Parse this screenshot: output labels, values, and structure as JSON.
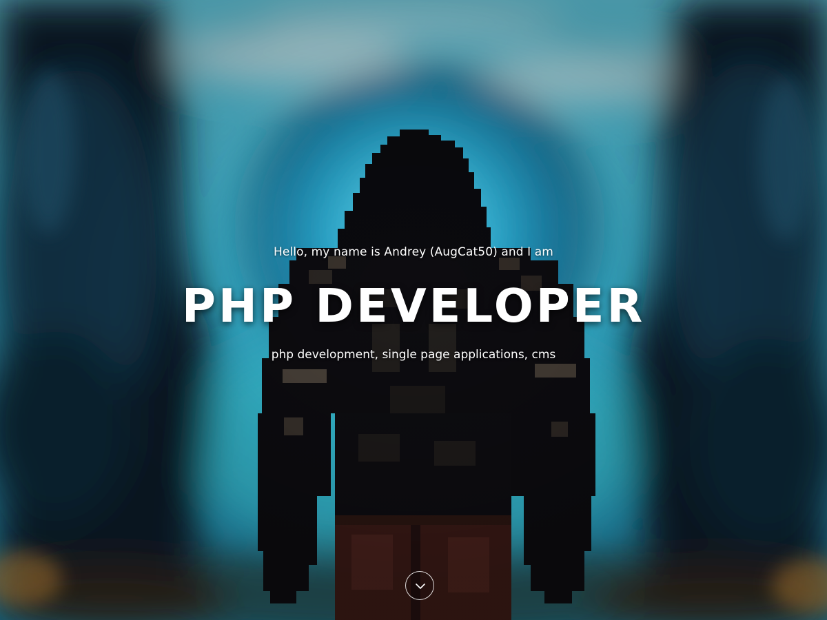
{
  "hero": {
    "intro": "Hello, my name is Andrey (AugCat50) and I am",
    "headline": "PHP DEVELOPER",
    "tagline": "php development, single page applications, cms"
  },
  "scroll_button": {
    "icon": "chevron-down-icon"
  },
  "colors": {
    "text": "#ffffff",
    "portal": "#2bb7d9",
    "figure": "#0a0a0e",
    "pants": "#4a1e18"
  }
}
